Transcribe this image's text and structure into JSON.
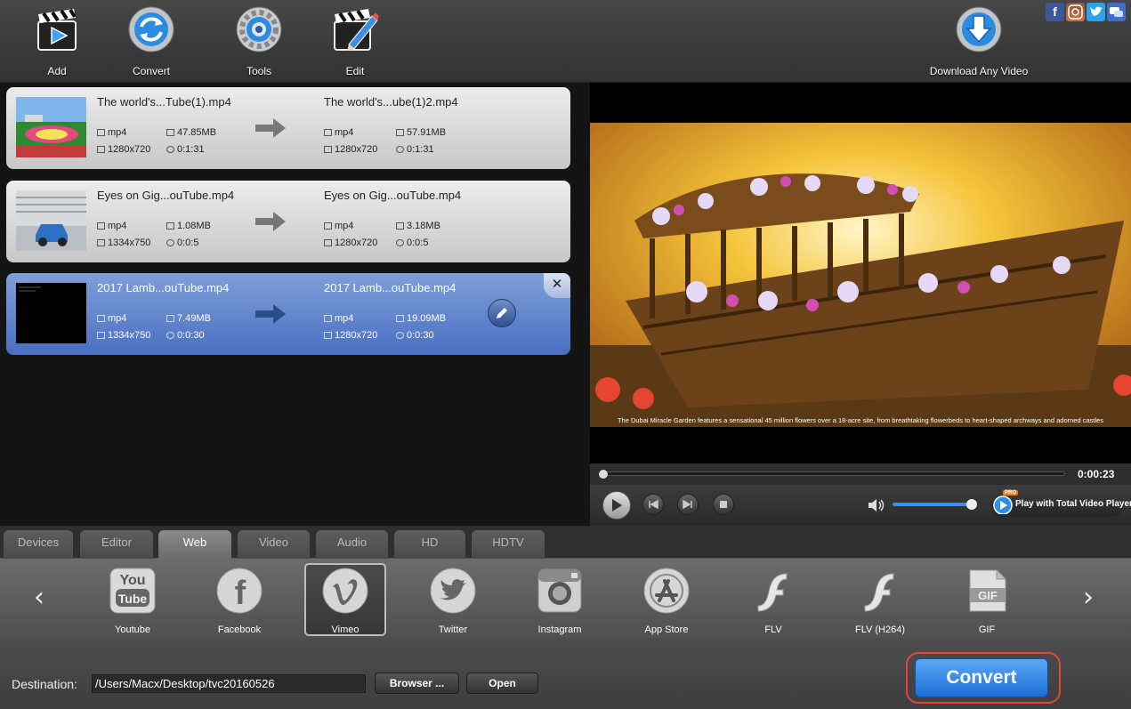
{
  "toolbar": {
    "add_label": "Add",
    "convert_label": "Convert",
    "tools_label": "Tools",
    "edit_label": "Edit",
    "download_label": "Download Any Video",
    "social": [
      "facebook-icon",
      "instagram-icon",
      "twitter-icon",
      "messenger-icon"
    ]
  },
  "files": [
    {
      "source": {
        "name": "The world's...Tube(1).mp4",
        "format": "mp4",
        "size": "47.85MB",
        "resolution": "1280x720",
        "duration": "0:1:31"
      },
      "output": {
        "name": "The world's...ube(1)2.mp4",
        "format": "mp4",
        "size": "57.91MB",
        "resolution": "1280x720",
        "duration": "0:1:31"
      }
    },
    {
      "source": {
        "name": "Eyes on Gig...ouTube.mp4",
        "format": "mp4",
        "size": "1.08MB",
        "resolution": "1334x750",
        "duration": "0:0:5"
      },
      "output": {
        "name": "Eyes on Gig...ouTube.mp4",
        "format": "mp4",
        "size": "3.18MB",
        "resolution": "1280x720",
        "duration": "0:0:5"
      }
    },
    {
      "source": {
        "name": "2017 Lamb...ouTube.mp4",
        "format": "mp4",
        "size": "7.49MB",
        "resolution": "1334x750",
        "duration": "0:0:30"
      },
      "output": {
        "name": "2017 Lamb...ouTube.mp4",
        "format": "mp4",
        "size": "19.09MB",
        "resolution": "1280x720",
        "duration": "0:0:30"
      }
    }
  ],
  "preview": {
    "caption": "The Dubai Miracle Garden features a sensational 45 million flowers over a 18-acre site, from breathtaking flowerbeds to heart-shaped archways and adorned castles",
    "time": "0:00:23",
    "progress": 0.0,
    "volume": 0.95,
    "play_with_label": "Play with Total Video Player",
    "pro_badge": "PRO"
  },
  "tabs": [
    "Devices",
    "Editor",
    "Web",
    "Video",
    "Audio",
    "HD",
    "HDTV"
  ],
  "active_tab": "Web",
  "profiles": [
    "Youtube",
    "Facebook",
    "Vimeo",
    "Twitter",
    "Instagram",
    "App Store",
    "FLV",
    "FLV (H264)",
    "GIF"
  ],
  "selected_profile": "Vimeo",
  "profile_icon_text": {
    "youtube_top": "You",
    "youtube_bottom": "Tube",
    "facebook": "f",
    "gif": "GIF"
  },
  "destination": {
    "label": "Destination:",
    "path": "/Users/Macx/Desktop/tvc20160526",
    "browse_label": "Browser ...",
    "open_label": "Open"
  },
  "convert_button_label": "Convert",
  "colors": {
    "accent_blue": "#2f7fe0",
    "selected_row": "#5a7fcb",
    "convert_highlight": "#e0463c"
  }
}
